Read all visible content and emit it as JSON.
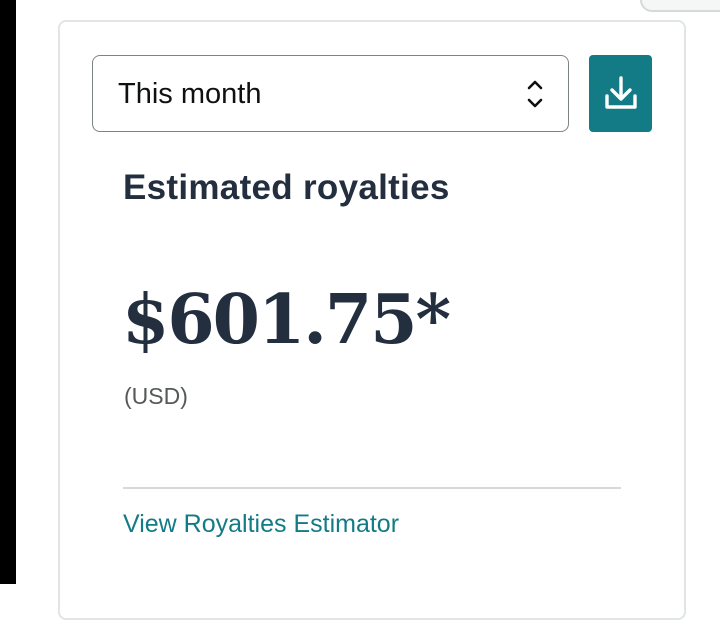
{
  "period_selector": {
    "selected": "This month",
    "icon": "up-down-chevron-icon"
  },
  "download": {
    "icon": "download-icon",
    "color": "#137b85"
  },
  "royalties": {
    "heading": "Estimated royalties",
    "amount": "$601.75*",
    "currency": "(USD)"
  },
  "footer": {
    "link_label": "View Royalties Estimator"
  },
  "colors": {
    "accent": "#137b85",
    "heading": "#232f3e",
    "muted": "#565959"
  }
}
